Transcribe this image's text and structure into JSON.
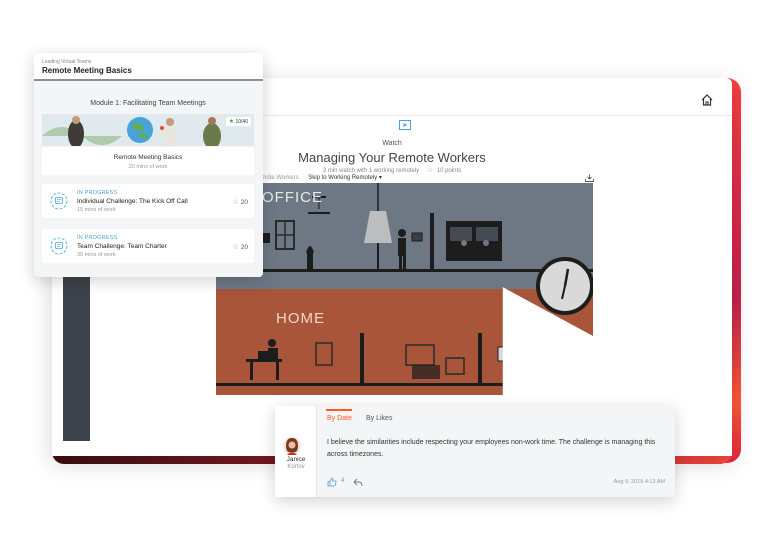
{
  "course": {
    "breadcrumb": "Leading Virtual Teams",
    "title": "Remote Meeting Basics",
    "module_title": "Module 1: Facilitating Team Meetings",
    "points_badge": "10/40",
    "hero_caption": "Remote Meeting Basics",
    "hero_duration": "20 mins of work",
    "challenges": [
      {
        "status": "IN PROGRESS",
        "name": "Individual Challenge: The Kick Off Call",
        "duration": "15 mins of work",
        "points": "20"
      },
      {
        "status": "IN PROGRESS",
        "name": "Team Challenge: Team Charter",
        "duration": "30 mins of work",
        "points": "20"
      }
    ]
  },
  "video_page": {
    "watch_label": "Watch",
    "title": "Managing Your Remote Workers",
    "meta": "3 min watch with 1 working remotely",
    "points": "10 points",
    "nav_prev": "emote Workers",
    "nav_skip": "Skip to Working Remotely ▾",
    "office_label": "OFFICE",
    "home_label": "HOME"
  },
  "comments": {
    "tab_date": "By Date",
    "tab_likes": "By Likes",
    "author_first": "Janice",
    "author_last": "Kortov",
    "text": "I believe the similarities include respecting your employees non-work time. The challenge is managing this across timezones.",
    "likes": "4",
    "date": "Aug 9, 2019 4:13 AM"
  },
  "colors": {
    "accent": "#ff5a1f",
    "link_blue": "#4aa3d8",
    "video_office": "#6e7884",
    "video_home": "#a8553a"
  }
}
